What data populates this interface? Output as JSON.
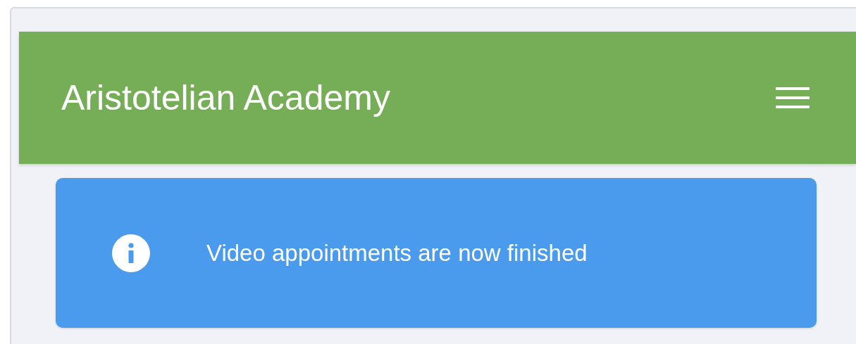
{
  "header": {
    "title": "Aristotelian Academy"
  },
  "alert": {
    "kind": "info",
    "message": "Video appointments are now finished"
  }
}
